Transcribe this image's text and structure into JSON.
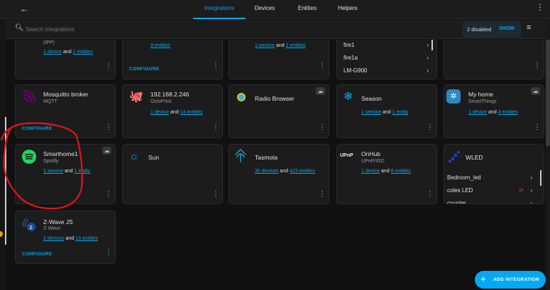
{
  "header": {
    "tabs": [
      {
        "label": "Integrations",
        "active": true
      },
      {
        "label": "Devices"
      },
      {
        "label": "Entities"
      },
      {
        "label": "Helpers"
      }
    ]
  },
  "search": {
    "placeholder": "Search integrations",
    "disabled_text": "2 disabled",
    "show_label": "SHOW"
  },
  "colors": {
    "accent": "#03a9f4",
    "annotation": "#e0141e"
  },
  "cards_top": {
    "c1": {
      "sub": "(IPP)",
      "l1": "1 device",
      "and": "and",
      "l2": "2 entities"
    },
    "c2": {
      "l2": "9 entities",
      "configure": "CONFIGURE"
    },
    "c3": {
      "l1": "1 service",
      "and": "and",
      "l2": "2 entities"
    },
    "c4": {
      "devices": [
        "fire1",
        "fire1a",
        "LM-G900"
      ]
    }
  },
  "cards": {
    "mosquitto": {
      "title": "Mosquitto broker",
      "sub": "MQTT",
      "configure": "CONFIGURE"
    },
    "octoprint": {
      "title": "192.168.2.246",
      "sub": "OctoPrint",
      "l1": "1 device",
      "and": "and",
      "l2": "14 entities"
    },
    "radio": {
      "title": "Radio Browser"
    },
    "season": {
      "title": "Season",
      "l1": "1 service",
      "and": "and",
      "l2": "1 entity"
    },
    "smartthings": {
      "title": "My home",
      "sub": "SmartThings",
      "l1": "1 device",
      "and": "and",
      "l2": "4 entities"
    },
    "spotify": {
      "title": "Smarthome1",
      "sub": "Spotify",
      "l1": "1 service",
      "and": "and",
      "l2": "1 entity"
    },
    "sun": {
      "title": "Sun"
    },
    "tasmota": {
      "title": "Tasmota",
      "l1": "30 devices",
      "and": "and",
      "l2": "423 entities"
    },
    "onhub": {
      "title": "OnHub",
      "sub": "UPnP/IGD",
      "l1": "1 device",
      "and": "and",
      "l2": "8 entities",
      "logo": "UPnP"
    },
    "wled": {
      "title": "WLED",
      "devices": [
        "Bedroom_led",
        "coles LED",
        "counter"
      ]
    },
    "zwave": {
      "title": "Z-Wave JS",
      "sub": "Z-Wave",
      "l1": "2 devices",
      "and": "and",
      "l2": "13 entities",
      "configure": "CONFIGURE"
    }
  },
  "fab": {
    "label": "ADD INTEGRATION"
  }
}
